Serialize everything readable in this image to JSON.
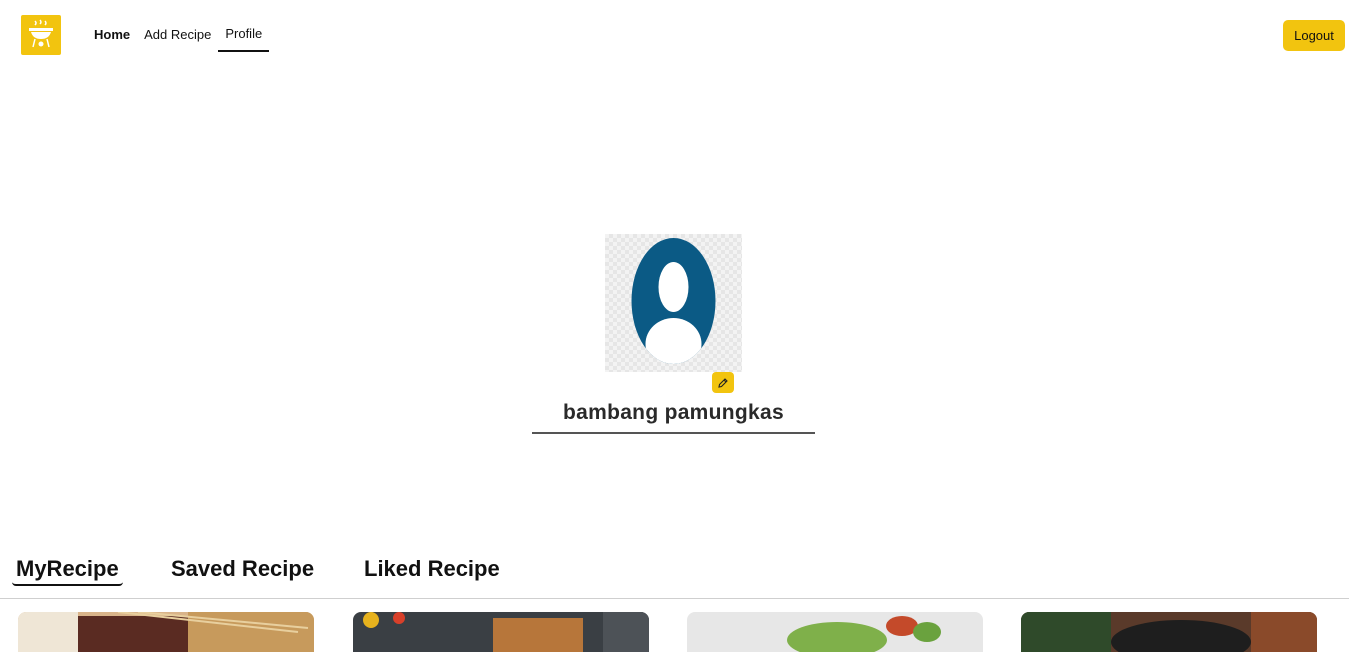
{
  "nav": {
    "logo_icon": "grill-logo-icon",
    "links": [
      {
        "label": "Home"
      },
      {
        "label": "Add Recipe"
      },
      {
        "label": "Profile"
      }
    ],
    "logout_label": "Logout"
  },
  "profile": {
    "avatar_icon": "user-avatar-icon",
    "edit_icon": "pencil-icon",
    "username": "bambang pamungkas"
  },
  "tabs": [
    {
      "label": "MyRecipe",
      "active": true
    },
    {
      "label": "Saved Recipe",
      "active": false
    },
    {
      "label": "Liked Recipe",
      "active": false
    }
  ],
  "colors": {
    "accent": "#f2c40f",
    "avatar": "#0b5a85"
  },
  "cards": [
    {
      "image": "satay-skewers-photo"
    },
    {
      "image": "grilled-food-photo"
    },
    {
      "image": "salad-bowl-photo"
    },
    {
      "image": "dark-bowl-dish-photo"
    }
  ]
}
